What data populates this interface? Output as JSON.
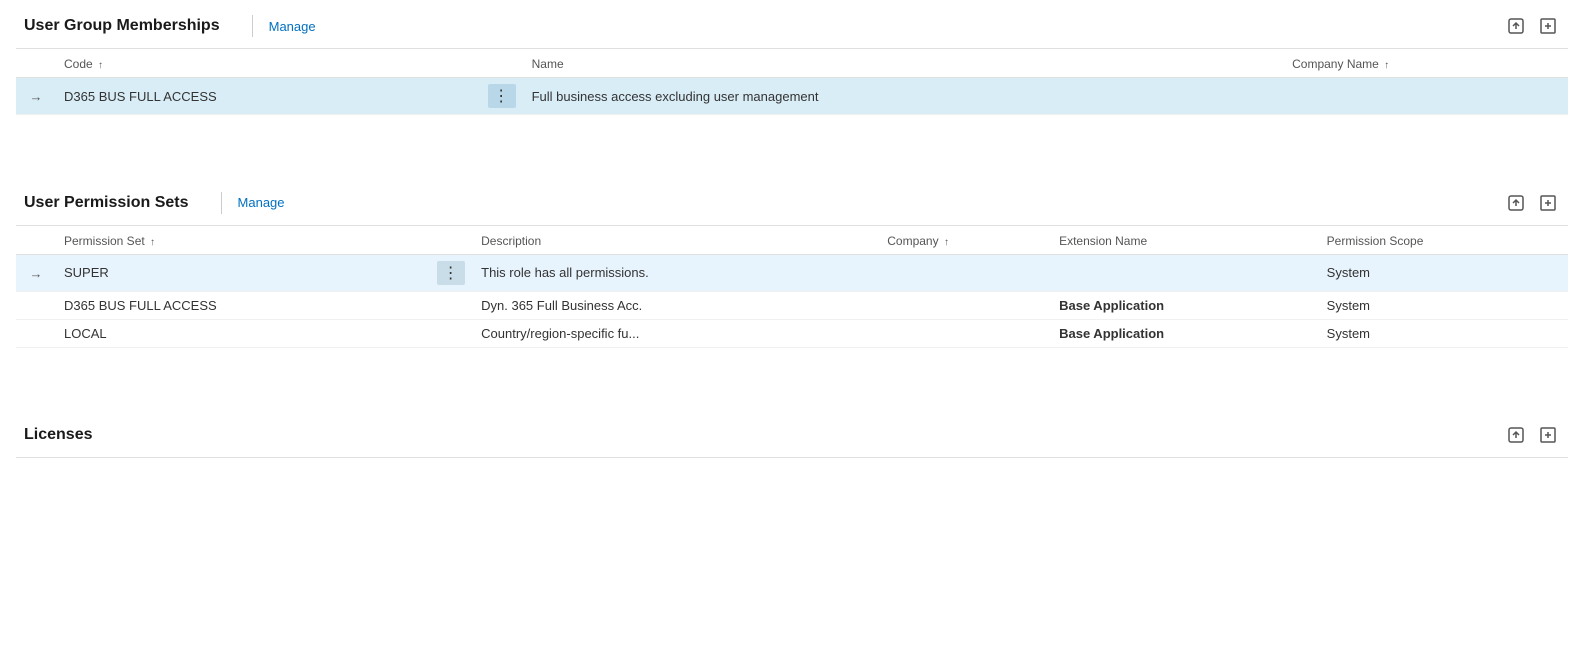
{
  "userGroupMemberships": {
    "title": "User Group Memberships",
    "manageLabel": "Manage",
    "columns": [
      {
        "id": "code",
        "label": "Code",
        "sortable": true
      },
      {
        "id": "name",
        "label": "Name",
        "sortable": false
      },
      {
        "id": "companyName",
        "label": "Company Name",
        "sortable": true
      }
    ],
    "rows": [
      {
        "code": "D365 BUS FULL ACCESS",
        "name": "Full business access excluding user management",
        "companyName": "",
        "highlighted": true,
        "hasArrow": true
      }
    ]
  },
  "userPermissionSets": {
    "title": "User Permission Sets",
    "manageLabel": "Manage",
    "columns": [
      {
        "id": "permissionSet",
        "label": "Permission Set",
        "sortable": true
      },
      {
        "id": "description",
        "label": "Description",
        "sortable": false
      },
      {
        "id": "company",
        "label": "Company",
        "sortable": true
      },
      {
        "id": "extensionName",
        "label": "Extension Name",
        "sortable": false
      },
      {
        "id": "permissionScope",
        "label": "Permission Scope",
        "sortable": false
      }
    ],
    "rows": [
      {
        "permissionSet": "SUPER",
        "description": "This role has all permissions.",
        "company": "",
        "extensionName": "",
        "permissionScope": "System",
        "hasArrow": true,
        "selected": true
      },
      {
        "permissionSet": "D365 BUS FULL ACCESS",
        "description": "Dyn. 365 Full Business Acc.",
        "company": "",
        "extensionName": "Base Application",
        "permissionScope": "System",
        "hasArrow": false,
        "selected": false
      },
      {
        "permissionSet": "LOCAL",
        "description": "Country/region-specific fu...",
        "company": "",
        "extensionName": "Base Application",
        "permissionScope": "System",
        "hasArrow": false,
        "selected": false
      }
    ]
  },
  "licenses": {
    "title": "Licenses"
  },
  "icons": {
    "share": "⬡",
    "export": "⬢",
    "sortAsc": "↑",
    "arrowRight": "→",
    "dots": "⋮"
  }
}
